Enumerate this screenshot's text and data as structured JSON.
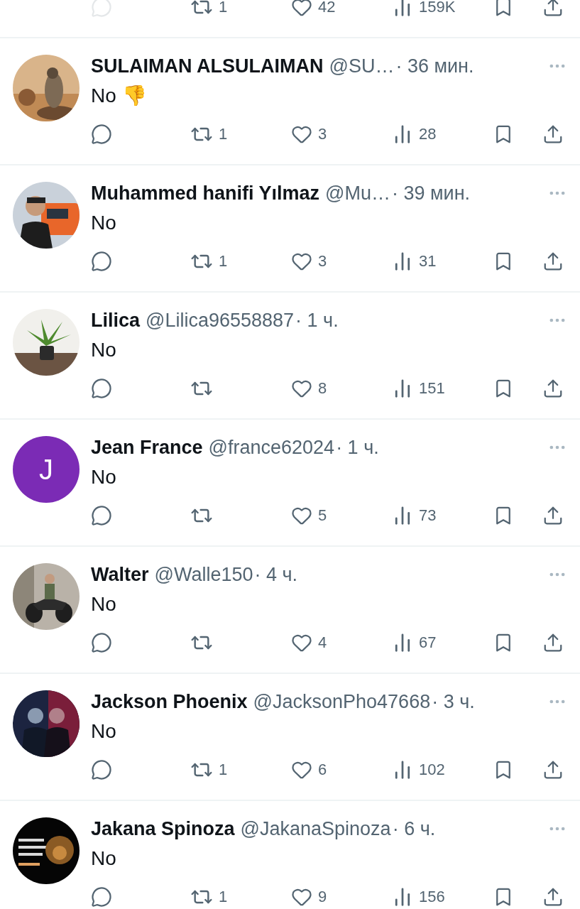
{
  "top_actions": {
    "retweets": "1",
    "likes": "42",
    "views": "159K"
  },
  "replies": [
    {
      "name": "SULAIMAN ALSULAIMAN",
      "handle": "@SU…",
      "time": "· 36 мин.",
      "text": "No 👎",
      "retweets": "1",
      "likes": "3",
      "views": "28"
    },
    {
      "name": "Muhammed hanifi Yılmaz",
      "handle": "@Mu…",
      "time": "· 39 мин.",
      "text": "No",
      "retweets": "1",
      "likes": "3",
      "views": "31"
    },
    {
      "name": "Lilica",
      "handle": "@Lilica96558887",
      "time": "· 1 ч.",
      "text": "No",
      "likes": "8",
      "views": "151"
    },
    {
      "name": "Jean France",
      "handle": "@france62024",
      "time": "· 1 ч.",
      "text": "No",
      "avatar": {
        "kind": "letter",
        "letter": "J"
      },
      "likes": "5",
      "views": "73"
    },
    {
      "name": "Walter",
      "handle": "@Walle150",
      "time": "· 4 ч.",
      "text": "No",
      "likes": "4",
      "views": "67"
    },
    {
      "name": "Jackson Phoenix",
      "handle": "@JacksonPho47668",
      "time": "· 3 ч.",
      "text": "No",
      "retweets": "1",
      "likes": "6",
      "views": "102"
    },
    {
      "name": "Jakana Spinoza",
      "handle": "@JakanaSpinoza",
      "time": "· 6 ч.",
      "text": "No",
      "retweets": "1",
      "likes": "9",
      "views": "156"
    }
  ]
}
